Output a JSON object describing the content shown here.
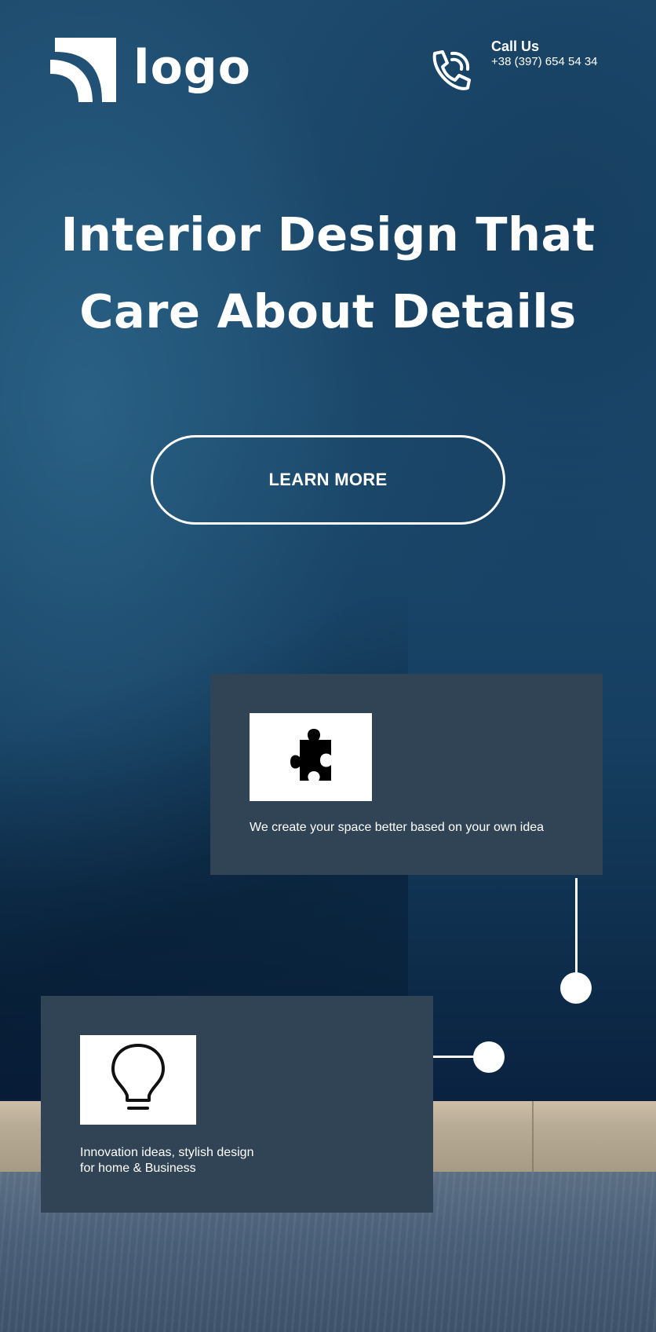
{
  "header": {
    "logo_text": "logo",
    "logo_icon": "rss-logo-mark",
    "contact": {
      "icon": "phone-icon",
      "label": "Call Us",
      "phone": "+38 (397) 654 54 34"
    }
  },
  "hero": {
    "title_line1": "Interior Design That",
    "title_line2": "Care About Details",
    "cta_label": "LEARN MORE"
  },
  "features": [
    {
      "icon": "puzzle-piece-icon",
      "text": "We create your space better based on your own idea"
    },
    {
      "icon": "lightbulb-icon",
      "text_line1": "Innovation ideas, stylish design",
      "text_line2": "for home & Business"
    }
  ],
  "colors": {
    "wall": "#1c4a6d",
    "card": "#304456",
    "text": "#ffffff"
  }
}
